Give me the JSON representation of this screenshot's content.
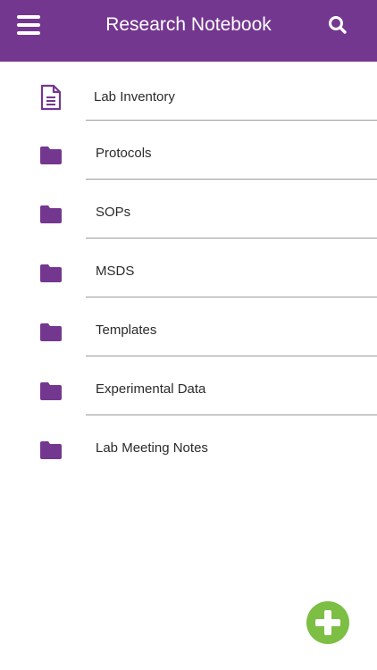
{
  "app_bar": {
    "title": "Research Notebook",
    "background_color": "#743790",
    "menu_icon": "hamburger-menu-icon",
    "search_icon": "search-icon"
  },
  "notebook_items": [
    {
      "label": "Lab Inventory",
      "icon": "document-icon"
    },
    {
      "label": "Protocols",
      "icon": "folder-icon"
    },
    {
      "label": "SOPs",
      "icon": "folder-icon"
    },
    {
      "label": "MSDS",
      "icon": "folder-icon"
    },
    {
      "label": "Templates",
      "icon": "folder-icon"
    },
    {
      "label": "Experimental Data",
      "icon": "folder-icon"
    },
    {
      "label": "Lab Meeting Notes",
      "icon": "folder-icon"
    }
  ],
  "fab": {
    "icon": "plus-icon",
    "color": "#7cbf44"
  },
  "colors": {
    "accent": "#743790",
    "divider": "#9b9b9b",
    "text": "#2b2b2b"
  }
}
